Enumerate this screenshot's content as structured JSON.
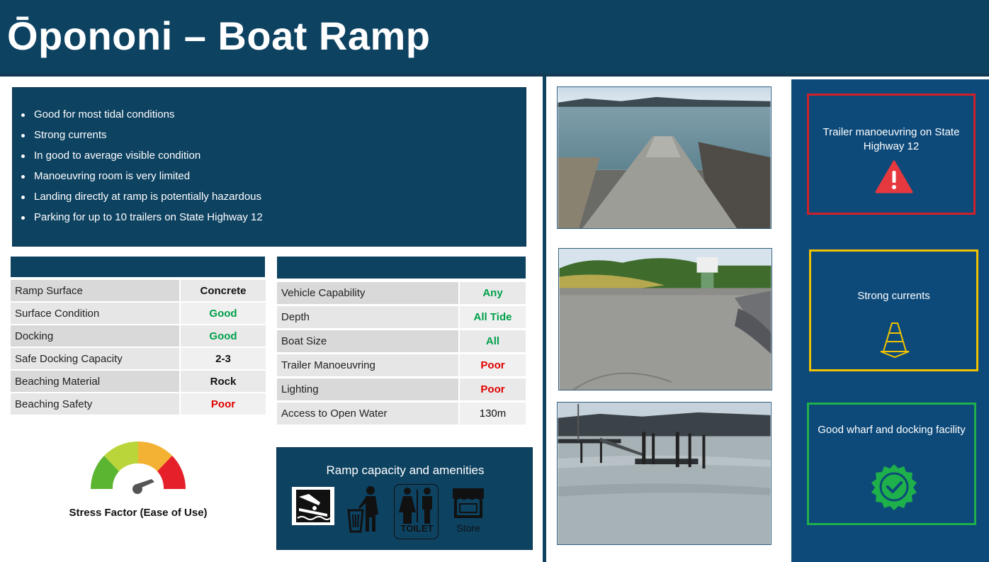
{
  "header": {
    "title": "Ōpononi – Boat Ramp"
  },
  "info": {
    "bullets": [
      "Good for most tidal conditions",
      "Strong currents",
      "In good to average visible condition",
      "Manoeuvring room is very limited",
      "Landing directly at ramp is potentially hazardous",
      "Parking for up to 10 trailers on State Highway 12"
    ]
  },
  "table_left": {
    "rows": [
      {
        "label": "Ramp Surface",
        "value": "Concrete",
        "color": "#111111"
      },
      {
        "label": "Surface Condition",
        "value": "Good",
        "color": "#00a04a"
      },
      {
        "label": "Docking",
        "value": "Good",
        "color": "#00a04a"
      },
      {
        "label": "Safe Docking Capacity",
        "value": "2-3",
        "color": "#111111"
      },
      {
        "label": "Beaching Material",
        "value": "Rock",
        "color": "#111111"
      },
      {
        "label": "Beaching Safety",
        "value": "Poor",
        "color": "#e00000"
      }
    ]
  },
  "table_right": {
    "rows": [
      {
        "label": "Vehicle Capability",
        "value": "Any",
        "color": "#00a04a"
      },
      {
        "label": "Depth",
        "value": "All Tide",
        "color": "#00a04a"
      },
      {
        "label": "Boat Size",
        "value": "All",
        "color": "#00a04a"
      },
      {
        "label": "Trailer Manoeuvring",
        "value": "Poor",
        "color": "#e00000"
      },
      {
        "label": "Lighting",
        "value": "Poor",
        "color": "#e00000"
      },
      {
        "label": "Access to Open Water",
        "value": "130m",
        "color": "#111111"
      }
    ]
  },
  "gauge": {
    "label": "Stress Factor (Ease of Use)",
    "level": 0.45
  },
  "amenities": {
    "title": "Ramp capacity and amenities",
    "items": [
      {
        "icon": "boat-ramp-icon"
      },
      {
        "icon": "rubbish-bin-icon"
      },
      {
        "icon": "toilet-icon",
        "label": "TOILET"
      },
      {
        "icon": "store-icon",
        "label": "Store"
      }
    ]
  },
  "photos": [
    {
      "subject": "ramp-to-sea"
    },
    {
      "subject": "ramp-to-road"
    },
    {
      "subject": "wharf-pontoon"
    }
  ],
  "cards": [
    {
      "text": "Trailer manoeuvring on State Highway 12",
      "border_color": "#d0202a",
      "icon": "warning-icon"
    },
    {
      "text": "Strong currents",
      "border_color": "#f2c200",
      "icon": "traffic-cone-icon"
    },
    {
      "text": "Good wharf and docking facility",
      "border_color": "#1eb04a",
      "icon": "check-badge-icon"
    }
  ],
  "colors": {
    "navy": "#0d4261",
    "panel_blue": "#0d4a7a",
    "good": "#00a04a",
    "poor": "#e00000"
  }
}
